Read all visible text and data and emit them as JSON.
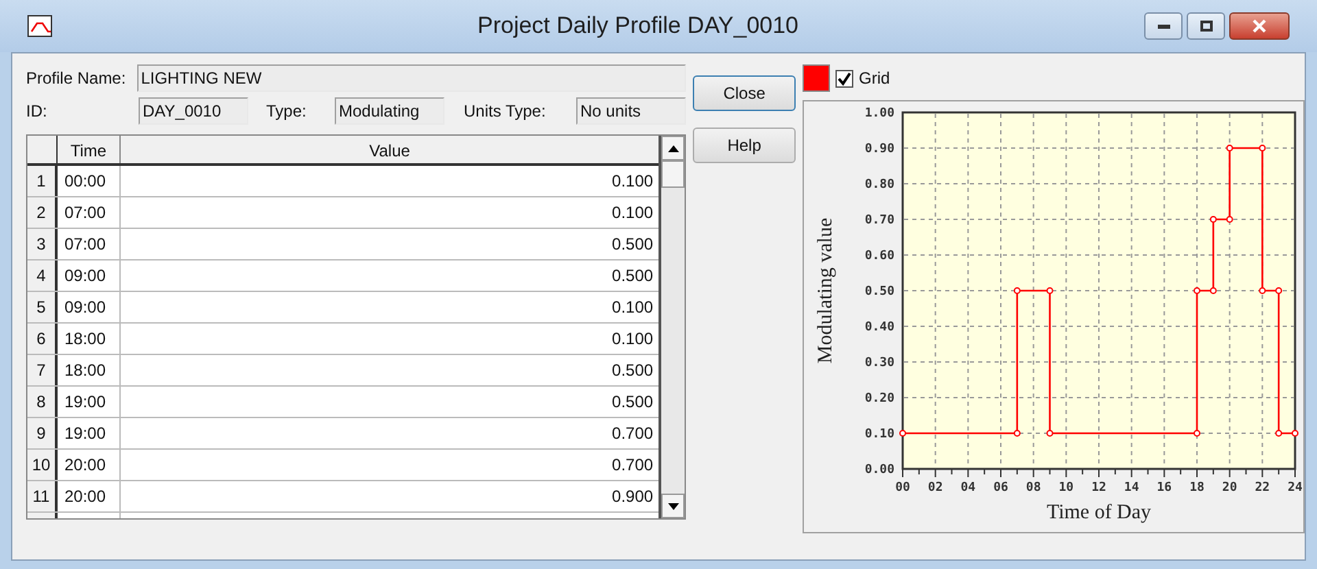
{
  "window": {
    "title": "Project Daily Profile DAY_0010"
  },
  "fields": {
    "profile_name_label": "Profile Name:",
    "profile_name": "LIGHTING NEW",
    "id_label": "ID:",
    "id": "DAY_0010",
    "type_label": "Type:",
    "type": "Modulating",
    "units_label": "Units Type:",
    "units": "No units"
  },
  "table": {
    "columns": [
      "Time",
      "Value"
    ],
    "rows": [
      {
        "index": "1",
        "time": "00:00",
        "value": "0.100"
      },
      {
        "index": "2",
        "time": "07:00",
        "value": "0.100"
      },
      {
        "index": "3",
        "time": "07:00",
        "value": "0.500"
      },
      {
        "index": "4",
        "time": "09:00",
        "value": "0.500"
      },
      {
        "index": "5",
        "time": "09:00",
        "value": "0.100"
      },
      {
        "index": "6",
        "time": "18:00",
        "value": "0.100"
      },
      {
        "index": "7",
        "time": "18:00",
        "value": "0.500"
      },
      {
        "index": "8",
        "time": "19:00",
        "value": "0.500"
      },
      {
        "index": "9",
        "time": "19:00",
        "value": "0.700"
      },
      {
        "index": "10",
        "time": "20:00",
        "value": "0.700"
      },
      {
        "index": "11",
        "time": "20:00",
        "value": "0.900"
      }
    ]
  },
  "buttons": [
    "Close",
    "Help"
  ],
  "chart_toolbar": {
    "grid_label": "Grid",
    "grid_checked": true
  },
  "chart": {
    "chart_data": {
      "type": "line",
      "grid": true,
      "xlabel": "Time of Day",
      "ylabel": "Modulating value",
      "x": [
        0,
        7,
        7,
        9,
        9,
        18,
        18,
        19,
        19,
        20,
        20,
        22,
        22,
        23,
        23,
        24
      ],
      "series": [
        {
          "color": "#ff0000",
          "marker": true,
          "values": [
            0.1,
            0.1,
            0.5,
            0.5,
            0.1,
            0.1,
            0.5,
            0.5,
            0.7,
            0.7,
            0.9,
            0.9,
            0.5,
            0.5,
            0.1,
            0.1
          ]
        }
      ],
      "xlim": [
        0,
        24
      ],
      "ylim": [
        0,
        1
      ],
      "xticks": [
        {
          "value": 0,
          "label": "00"
        },
        {
          "value": 2,
          "label": "02"
        },
        {
          "value": 4,
          "label": "04"
        },
        {
          "value": 6,
          "label": "06"
        },
        {
          "value": 8,
          "label": "08"
        },
        {
          "value": 10,
          "label": "10"
        },
        {
          "value": 12,
          "label": "12"
        },
        {
          "value": 14,
          "label": "14"
        },
        {
          "value": 16,
          "label": "16"
        },
        {
          "value": 18,
          "label": "18"
        },
        {
          "value": 20,
          "label": "20"
        },
        {
          "value": 22,
          "label": "22"
        },
        {
          "value": 24,
          "label": "24"
        }
      ],
      "yticks": [
        {
          "value": 0,
          "label": "0.00"
        },
        {
          "value": 0.1,
          "label": "0.10"
        },
        {
          "value": 0.2,
          "label": "0.20"
        },
        {
          "value": 0.3,
          "label": "0.30"
        },
        {
          "value": 0.4,
          "label": "0.40"
        },
        {
          "value": 0.5,
          "label": "0.50"
        },
        {
          "value": 0.6,
          "label": "0.60"
        },
        {
          "value": 0.7,
          "label": "0.70"
        },
        {
          "value": 0.8,
          "label": "0.80"
        },
        {
          "value": 0.9,
          "label": "0.90"
        },
        {
          "value": 1,
          "label": "1.00"
        }
      ]
    }
  }
}
